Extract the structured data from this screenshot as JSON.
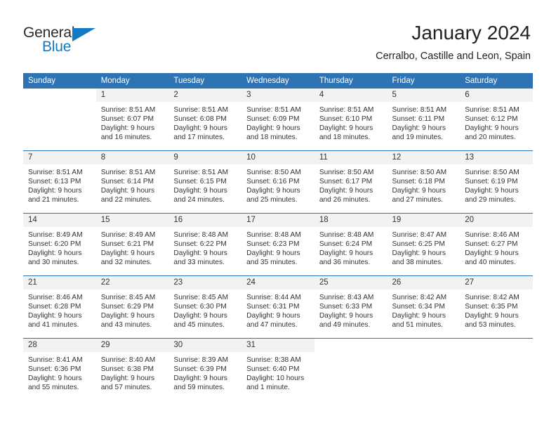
{
  "brand": {
    "name_part1": "General",
    "name_part2": "Blue",
    "triangle_icon": "triangle-icon",
    "accent_color": "#1479c4"
  },
  "header": {
    "month_title": "January 2024",
    "location": "Cerralbo, Castille and Leon, Spain"
  },
  "theme": {
    "header_blue": "#2e74b5",
    "daynum_gray": "#f2f2f2",
    "text": "#333333"
  },
  "calendar": {
    "weekday_headers": [
      "Sunday",
      "Monday",
      "Tuesday",
      "Wednesday",
      "Thursday",
      "Friday",
      "Saturday"
    ],
    "weeks": [
      [
        {
          "day": "",
          "lines": []
        },
        {
          "day": "1",
          "lines": [
            "Sunrise: 8:51 AM",
            "Sunset: 6:07 PM",
            "Daylight: 9 hours",
            "and 16 minutes."
          ]
        },
        {
          "day": "2",
          "lines": [
            "Sunrise: 8:51 AM",
            "Sunset: 6:08 PM",
            "Daylight: 9 hours",
            "and 17 minutes."
          ]
        },
        {
          "day": "3",
          "lines": [
            "Sunrise: 8:51 AM",
            "Sunset: 6:09 PM",
            "Daylight: 9 hours",
            "and 18 minutes."
          ]
        },
        {
          "day": "4",
          "lines": [
            "Sunrise: 8:51 AM",
            "Sunset: 6:10 PM",
            "Daylight: 9 hours",
            "and 18 minutes."
          ]
        },
        {
          "day": "5",
          "lines": [
            "Sunrise: 8:51 AM",
            "Sunset: 6:11 PM",
            "Daylight: 9 hours",
            "and 19 minutes."
          ]
        },
        {
          "day": "6",
          "lines": [
            "Sunrise: 8:51 AM",
            "Sunset: 6:12 PM",
            "Daylight: 9 hours",
            "and 20 minutes."
          ]
        }
      ],
      [
        {
          "day": "7",
          "lines": [
            "Sunrise: 8:51 AM",
            "Sunset: 6:13 PM",
            "Daylight: 9 hours",
            "and 21 minutes."
          ]
        },
        {
          "day": "8",
          "lines": [
            "Sunrise: 8:51 AM",
            "Sunset: 6:14 PM",
            "Daylight: 9 hours",
            "and 22 minutes."
          ]
        },
        {
          "day": "9",
          "lines": [
            "Sunrise: 8:51 AM",
            "Sunset: 6:15 PM",
            "Daylight: 9 hours",
            "and 24 minutes."
          ]
        },
        {
          "day": "10",
          "lines": [
            "Sunrise: 8:50 AM",
            "Sunset: 6:16 PM",
            "Daylight: 9 hours",
            "and 25 minutes."
          ]
        },
        {
          "day": "11",
          "lines": [
            "Sunrise: 8:50 AM",
            "Sunset: 6:17 PM",
            "Daylight: 9 hours",
            "and 26 minutes."
          ]
        },
        {
          "day": "12",
          "lines": [
            "Sunrise: 8:50 AM",
            "Sunset: 6:18 PM",
            "Daylight: 9 hours",
            "and 27 minutes."
          ]
        },
        {
          "day": "13",
          "lines": [
            "Sunrise: 8:50 AM",
            "Sunset: 6:19 PM",
            "Daylight: 9 hours",
            "and 29 minutes."
          ]
        }
      ],
      [
        {
          "day": "14",
          "lines": [
            "Sunrise: 8:49 AM",
            "Sunset: 6:20 PM",
            "Daylight: 9 hours",
            "and 30 minutes."
          ]
        },
        {
          "day": "15",
          "lines": [
            "Sunrise: 8:49 AM",
            "Sunset: 6:21 PM",
            "Daylight: 9 hours",
            "and 32 minutes."
          ]
        },
        {
          "day": "16",
          "lines": [
            "Sunrise: 8:48 AM",
            "Sunset: 6:22 PM",
            "Daylight: 9 hours",
            "and 33 minutes."
          ]
        },
        {
          "day": "17",
          "lines": [
            "Sunrise: 8:48 AM",
            "Sunset: 6:23 PM",
            "Daylight: 9 hours",
            "and 35 minutes."
          ]
        },
        {
          "day": "18",
          "lines": [
            "Sunrise: 8:48 AM",
            "Sunset: 6:24 PM",
            "Daylight: 9 hours",
            "and 36 minutes."
          ]
        },
        {
          "day": "19",
          "lines": [
            "Sunrise: 8:47 AM",
            "Sunset: 6:25 PM",
            "Daylight: 9 hours",
            "and 38 minutes."
          ]
        },
        {
          "day": "20",
          "lines": [
            "Sunrise: 8:46 AM",
            "Sunset: 6:27 PM",
            "Daylight: 9 hours",
            "and 40 minutes."
          ]
        }
      ],
      [
        {
          "day": "21",
          "lines": [
            "Sunrise: 8:46 AM",
            "Sunset: 6:28 PM",
            "Daylight: 9 hours",
            "and 41 minutes."
          ]
        },
        {
          "day": "22",
          "lines": [
            "Sunrise: 8:45 AM",
            "Sunset: 6:29 PM",
            "Daylight: 9 hours",
            "and 43 minutes."
          ]
        },
        {
          "day": "23",
          "lines": [
            "Sunrise: 8:45 AM",
            "Sunset: 6:30 PM",
            "Daylight: 9 hours",
            "and 45 minutes."
          ]
        },
        {
          "day": "24",
          "lines": [
            "Sunrise: 8:44 AM",
            "Sunset: 6:31 PM",
            "Daylight: 9 hours",
            "and 47 minutes."
          ]
        },
        {
          "day": "25",
          "lines": [
            "Sunrise: 8:43 AM",
            "Sunset: 6:33 PM",
            "Daylight: 9 hours",
            "and 49 minutes."
          ]
        },
        {
          "day": "26",
          "lines": [
            "Sunrise: 8:42 AM",
            "Sunset: 6:34 PM",
            "Daylight: 9 hours",
            "and 51 minutes."
          ]
        },
        {
          "day": "27",
          "lines": [
            "Sunrise: 8:42 AM",
            "Sunset: 6:35 PM",
            "Daylight: 9 hours",
            "and 53 minutes."
          ]
        }
      ],
      [
        {
          "day": "28",
          "lines": [
            "Sunrise: 8:41 AM",
            "Sunset: 6:36 PM",
            "Daylight: 9 hours",
            "and 55 minutes."
          ]
        },
        {
          "day": "29",
          "lines": [
            "Sunrise: 8:40 AM",
            "Sunset: 6:38 PM",
            "Daylight: 9 hours",
            "and 57 minutes."
          ]
        },
        {
          "day": "30",
          "lines": [
            "Sunrise: 8:39 AM",
            "Sunset: 6:39 PM",
            "Daylight: 9 hours",
            "and 59 minutes."
          ]
        },
        {
          "day": "31",
          "lines": [
            "Sunrise: 8:38 AM",
            "Sunset: 6:40 PM",
            "Daylight: 10 hours",
            "and 1 minute."
          ]
        },
        {
          "day": "",
          "lines": []
        },
        {
          "day": "",
          "lines": []
        },
        {
          "day": "",
          "lines": []
        }
      ]
    ]
  }
}
